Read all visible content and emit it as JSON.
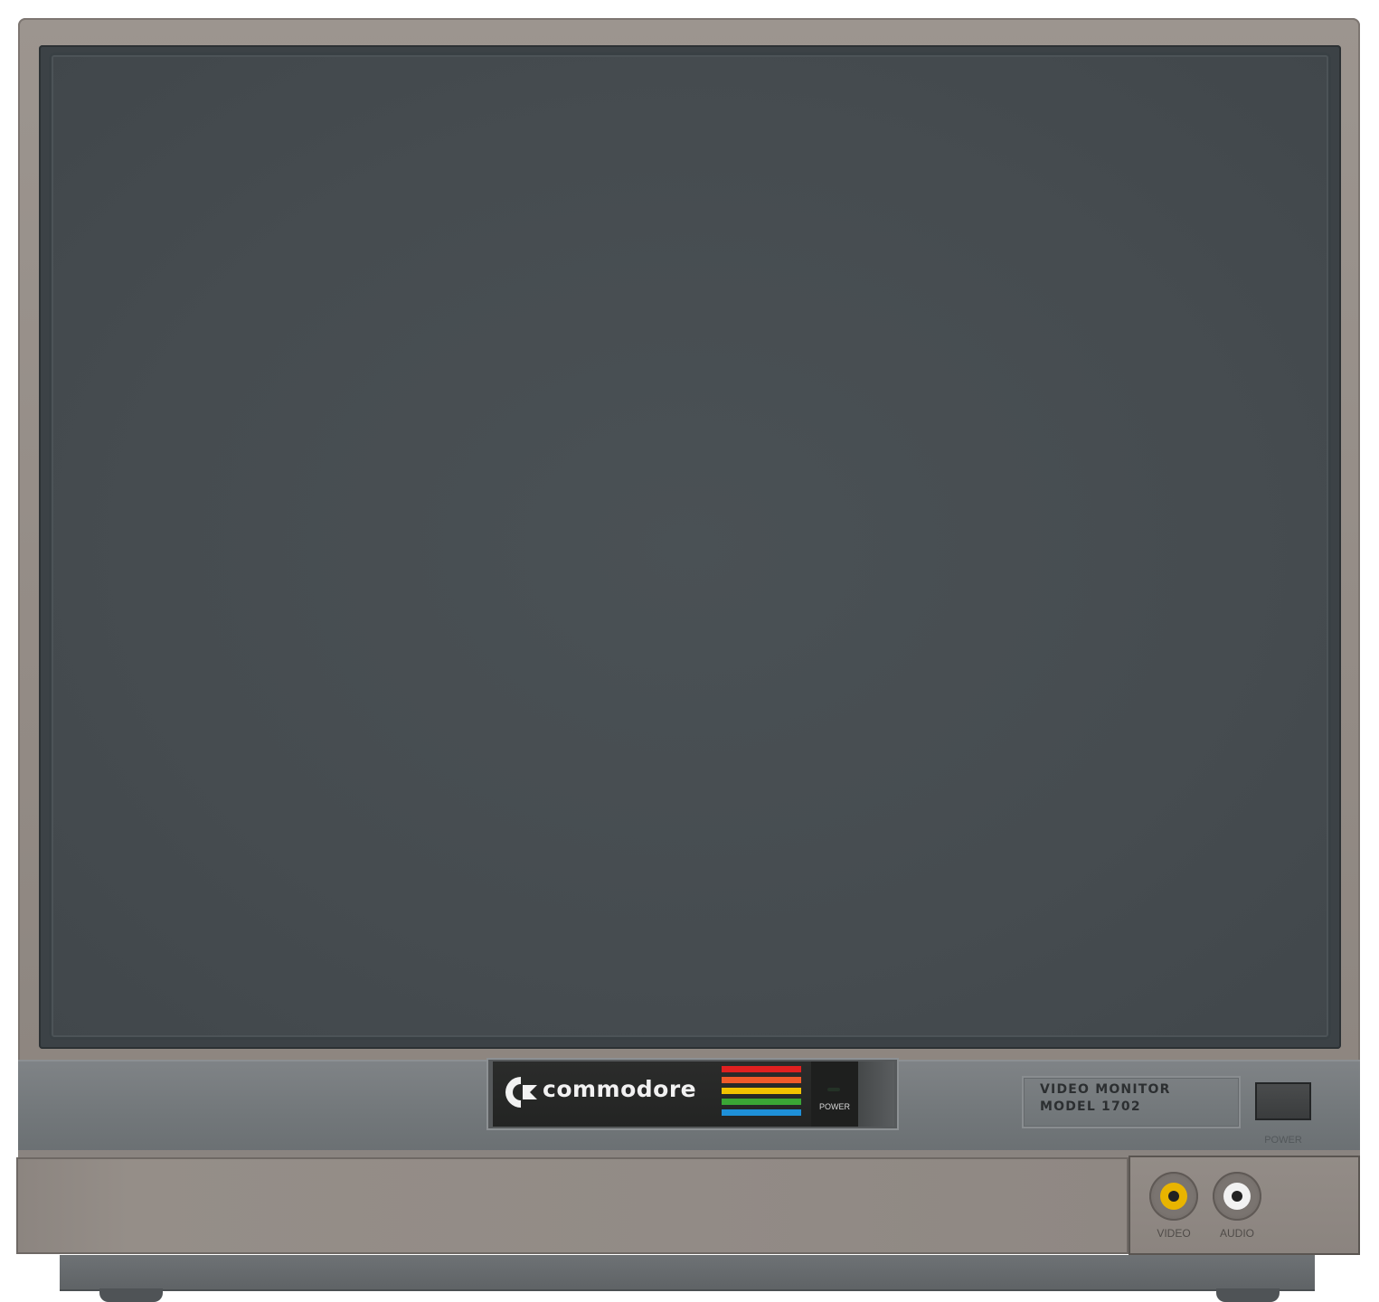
{
  "monitor": {
    "brand": "commodore",
    "colors": {
      "cabinet": "#938b85",
      "screen": "#464c50",
      "strip": "#73787b",
      "badge": "#262726"
    },
    "logo_stripes": [
      "#e02020",
      "#f05a2a",
      "#f2c200",
      "#3aa635",
      "#1e90d8"
    ],
    "badge_power_label": "POWER",
    "model_plate": {
      "line1": "VIDEO MONITOR",
      "line2": "MODEL 1702"
    },
    "power_button_label": "POWER",
    "jacks": [
      {
        "label": "VIDEO",
        "color": "#e8b400"
      },
      {
        "label": "AUDIO",
        "color": "#f2f2f2"
      }
    ]
  }
}
